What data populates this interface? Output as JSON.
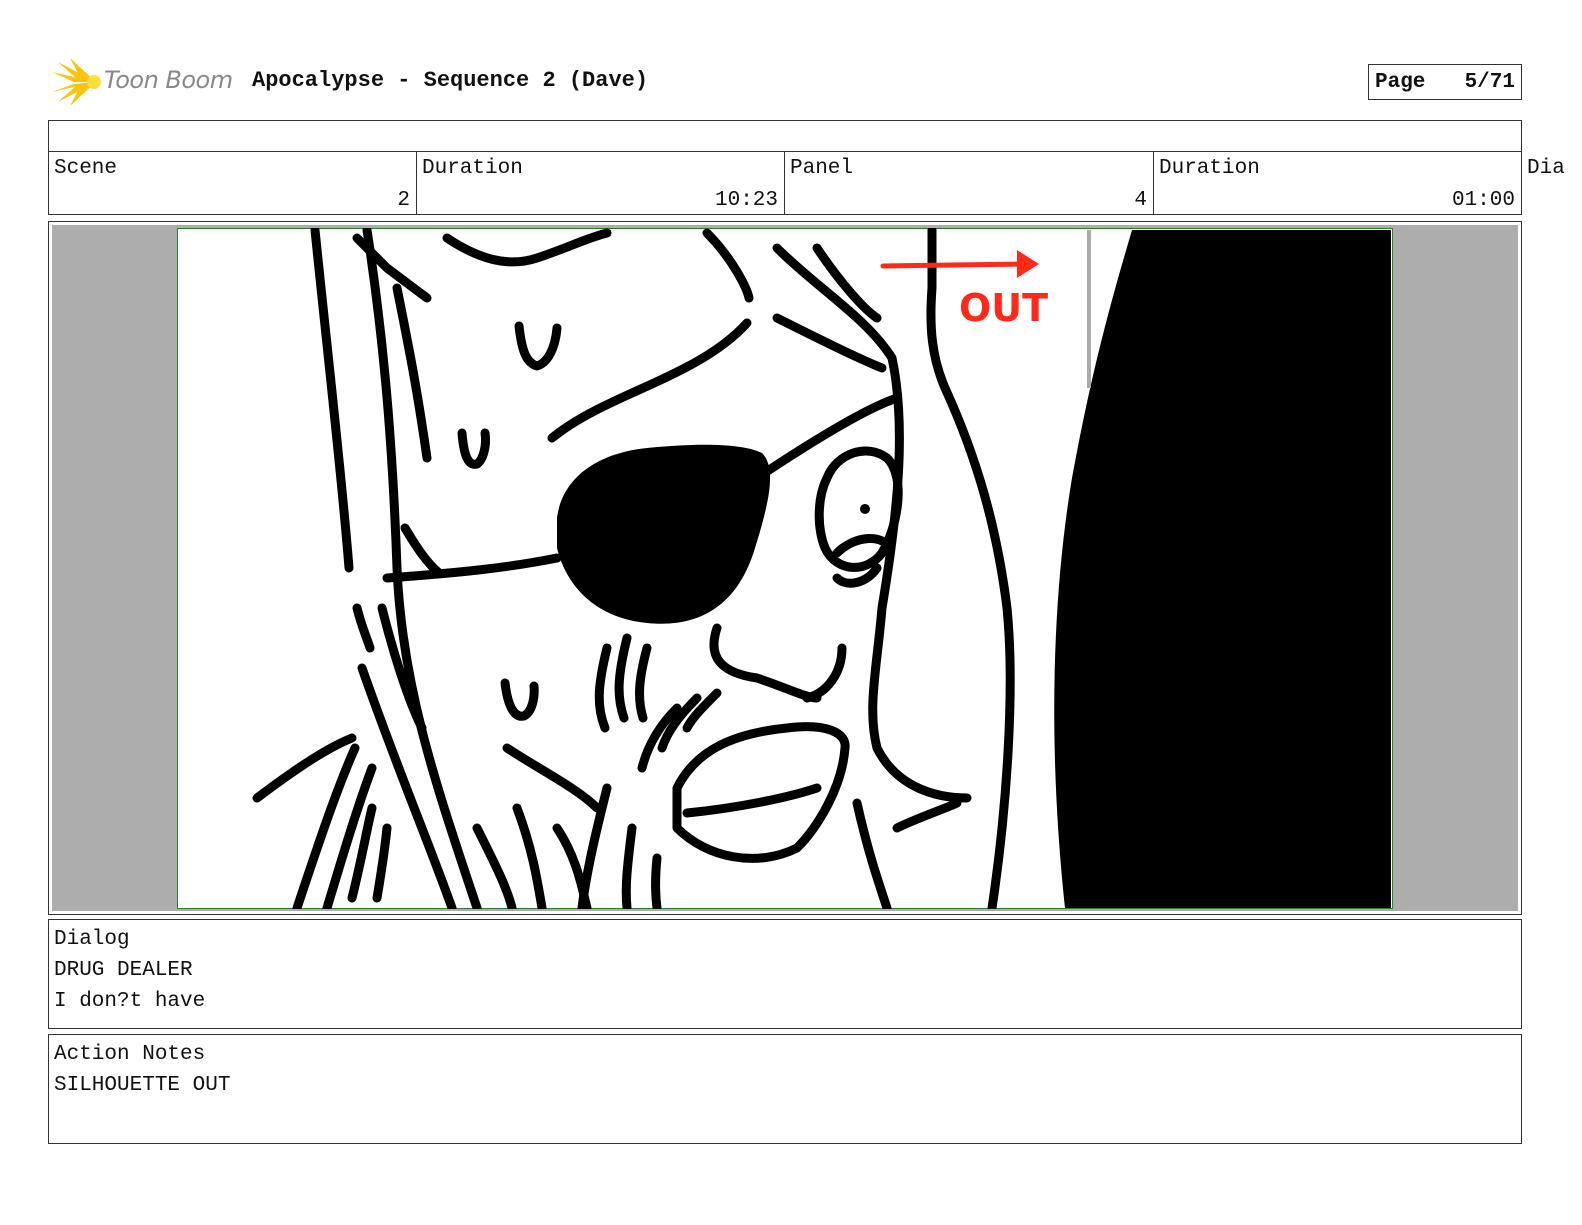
{
  "header": {
    "logo_text": "Toon Boom",
    "title": "Apocalypse - Sequence 2 (Dave)",
    "page_label": "Page",
    "page_value": "5/71"
  },
  "info": {
    "scene_label": "Scene",
    "scene_value": "2",
    "duration_label": "Duration",
    "duration_value": "10:23",
    "panel_label": "Panel",
    "panel_value": "4",
    "panel_duration_label": "Duration",
    "panel_duration_value": "01:00",
    "overflow_label": "Dia"
  },
  "sketch": {
    "annotation": "OUT",
    "annotation_color": "#ff2a1a",
    "frame_color": "#2e7d32"
  },
  "dialog": {
    "label": "Dialog",
    "character": "DRUG DEALER",
    "line": "I don?t have"
  },
  "action_notes": {
    "label": "Action Notes",
    "text": "SILHOUETTE OUT"
  }
}
